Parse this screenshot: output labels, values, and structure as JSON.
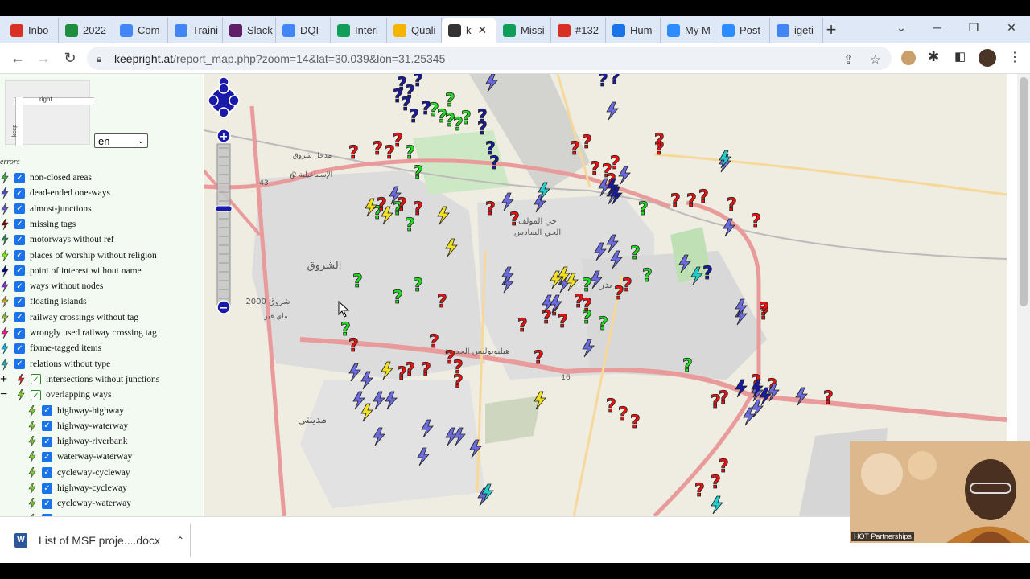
{
  "browser": {
    "tabs": [
      {
        "label": "Inbo",
        "icon": "gmail-icon",
        "color": "#d93025"
      },
      {
        "label": "2022",
        "icon": "drive-icon",
        "color": "#1e8e3e"
      },
      {
        "label": "Com",
        "icon": "docs-icon",
        "color": "#4285f4"
      },
      {
        "label": "Traini",
        "icon": "docs-icon",
        "color": "#4285f4"
      },
      {
        "label": "Slack",
        "icon": "slack-icon",
        "color": "#611f69"
      },
      {
        "label": "DQI",
        "icon": "docs-icon",
        "color": "#4285f4"
      },
      {
        "label": "Interi",
        "icon": "sheets-icon",
        "color": "#0f9d58"
      },
      {
        "label": "Quali",
        "icon": "slides-icon",
        "color": "#f4b400"
      },
      {
        "label": "k",
        "icon": "keepright-icon",
        "color": "#333333",
        "active": true
      },
      {
        "label": "Missi",
        "icon": "sheets-icon",
        "color": "#0f9d58"
      },
      {
        "label": "#132",
        "icon": "eye-icon",
        "color": "#d93025"
      },
      {
        "label": "Hum",
        "icon": "calendar-icon",
        "color": "#1a73e8"
      },
      {
        "label": "My M",
        "icon": "zoom-icon",
        "color": "#2d8cff"
      },
      {
        "label": "Post",
        "icon": "zoom-icon",
        "color": "#2d8cff"
      },
      {
        "label": "igeti",
        "icon": "google-icon",
        "color": "#4285f4"
      }
    ],
    "url_host": "keepright.at",
    "url_path": "/report_map.php?zoom=14&lat=30.039&lon=31.25345"
  },
  "sidebar": {
    "language": "en",
    "errors_label": "errors",
    "items": [
      {
        "label": "non-closed areas",
        "color": "#3cb44b"
      },
      {
        "label": "dead-ended one-ways",
        "color": "#4b4bd6"
      },
      {
        "label": "almost-junctions",
        "color": "#6a5acd"
      },
      {
        "label": "missing tags",
        "color": "#8b0000"
      },
      {
        "label": "motorways without ref",
        "color": "#2e8b57"
      },
      {
        "label": "places of worship without religion",
        "color": "#7cfc00"
      },
      {
        "label": "point of interest without name",
        "color": "#00008b"
      },
      {
        "label": "ways without nodes",
        "color": "#8a2be2"
      },
      {
        "label": "floating islands",
        "color": "#daa520"
      },
      {
        "label": "railway crossings without tag",
        "color": "#9acd32"
      },
      {
        "label": "wrongly used railway crossing tag",
        "color": "#ff1493"
      },
      {
        "label": "fixme-tagged items",
        "color": "#00bfff"
      },
      {
        "label": "relations without type",
        "color": "#20b2aa"
      }
    ],
    "group_intersections": {
      "label": "intersections without junctions",
      "toggle": "+"
    },
    "group_overlapping": {
      "label": "overlapping ways",
      "toggle": "−"
    },
    "sub_items": [
      {
        "label": "highway-highway"
      },
      {
        "label": "highway-waterway"
      },
      {
        "label": "highway-riverbank"
      },
      {
        "label": "waterway-waterway"
      },
      {
        "label": "cycleway-cycleway"
      },
      {
        "label": "highway-cycleway"
      },
      {
        "label": "cycleway-waterway"
      }
    ],
    "thumb_label_right": "right",
    "thumb_label_keep": "keep"
  },
  "map": {
    "labels": [
      {
        "text": "الشروق",
        "size": 13
      },
      {
        "text": "شروق 2000",
        "size": 10
      },
      {
        "text": "ماي فير",
        "size": 9
      },
      {
        "text": "مدينتي",
        "size": 13
      },
      {
        "text": "هيليوبوليس الجديدة",
        "size": 10
      },
      {
        "text": "حي المولف",
        "size": 10
      },
      {
        "text": "الحي السادس",
        "size": 10
      },
      {
        "text": "بدر",
        "size": 12
      },
      {
        "text": "مدخل شروق",
        "size": 9
      },
      {
        "text": "2 الإسماعيلية",
        "size": 9
      },
      {
        "text": "16",
        "size": 9
      },
      {
        "text": "43",
        "size": 9
      },
      {
        "text": "6",
        "size": 9
      }
    ],
    "zoom_plus": "+",
    "zoom_minus": "−"
  },
  "download": {
    "filename": "List of MSF proje....docx"
  },
  "video": {
    "label": "HOT Partnerships"
  }
}
